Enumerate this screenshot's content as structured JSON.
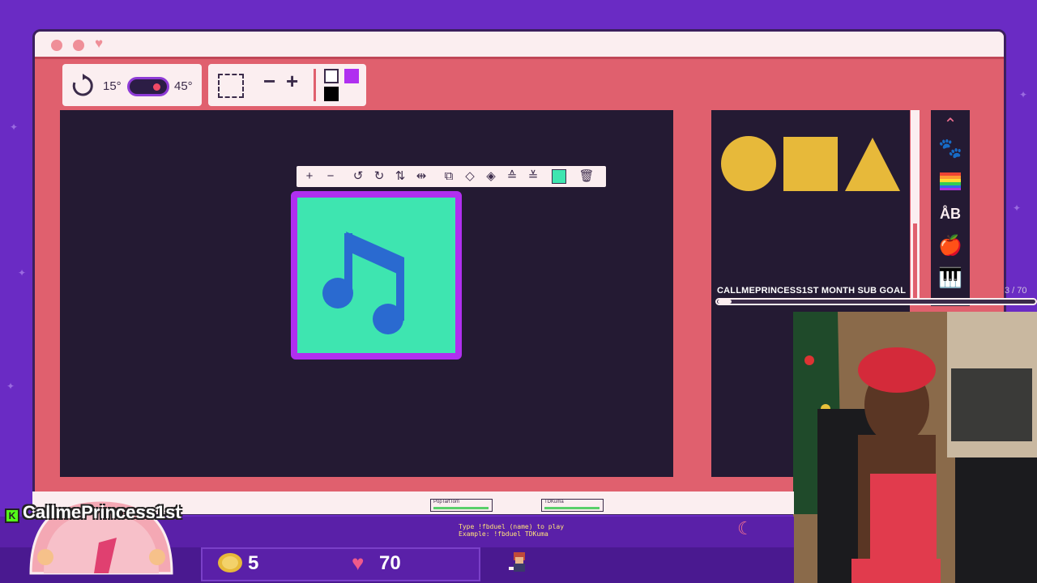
{
  "window": {
    "title_buttons": [
      "close-dot",
      "minimize-dot",
      "favorite-heart"
    ]
  },
  "toolbar": {
    "rotate_icon": "rotate-icon",
    "angle_small": "15°",
    "angle_large": "45°",
    "select_icon": "marquee-select-icon",
    "zoom_out": "−",
    "zoom_in": "+",
    "colors": {
      "primary": "#ffffff",
      "secondary": "#b02ff0",
      "tertiary": "#000000"
    }
  },
  "object_toolbar": {
    "icons": [
      "plus-icon",
      "minus-icon",
      "rotate-left-icon",
      "rotate-right-icon",
      "flip-vertical-icon",
      "flip-horizontal-icon",
      "duplicate-icon",
      "layer-up-icon",
      "layer-down-icon",
      "layer-top-icon",
      "layer-bottom-icon",
      "color-swatch",
      "trash-icon"
    ],
    "glyphs": [
      "+",
      "−",
      "↺",
      "↻",
      "⇅",
      "⇹",
      "⧉",
      "◇",
      "◈",
      "≙",
      "≚",
      "",
      "🗑"
    ],
    "swatch_color": "#3ee5b0"
  },
  "canvas": {
    "sticker": "music-note-sticker",
    "sticker_bg": "#3ee5b0",
    "sticker_border": "#b02ff0",
    "note_color": "#2a6ad0"
  },
  "shapes_panel": {
    "shapes": [
      "circle",
      "square",
      "triangle"
    ],
    "shape_color": "#e7b93a"
  },
  "tools_column": {
    "icons": [
      "chevron-up-icon",
      "paw-icon",
      "rainbow-flag-icon",
      "text-ab-icon",
      "apple-icon",
      "piano-icon"
    ],
    "glyphs": [
      "⌃",
      "🐾",
      "",
      "ÅB",
      "🍎",
      "🎹"
    ]
  },
  "sub_goal": {
    "title": "CALLMEPRINCESS1ST MONTH SUB GOAL",
    "count": "3 / 70",
    "progress": 0.043
  },
  "footer": {
    "card1": "PopTartTom",
    "card2": "TDKuma",
    "fbduel_line1": "Type !fbduel (name) to play",
    "fbduel_line2": "Example: !fbduel TDKuma"
  },
  "channel": {
    "name": "CallmePrincess1st",
    "platform_badge": "K"
  },
  "stats": {
    "coins": "5",
    "hearts": "70"
  },
  "colors": {
    "window": "#e0606e",
    "canvas": "#241a33",
    "accent": "#b02ff0"
  }
}
